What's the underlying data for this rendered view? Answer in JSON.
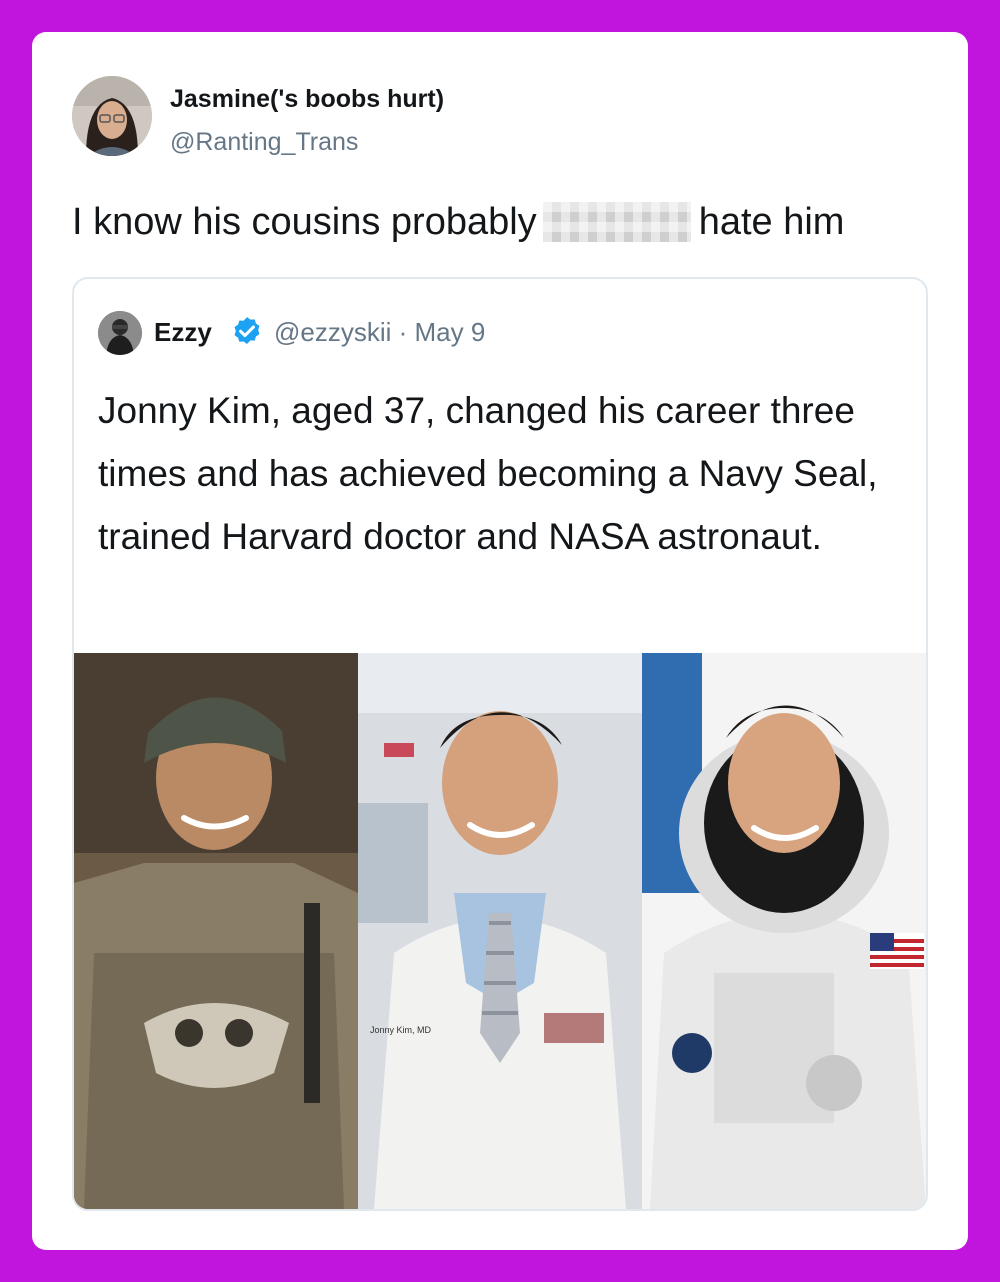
{
  "tweet": {
    "display_name": "Jasmine('s boobs hurt)",
    "handle": "@Ranting_Trans",
    "text_before": "I know his cousins probably",
    "text_after": "hate him"
  },
  "quoted_tweet": {
    "display_name": "Ezzy",
    "verified": true,
    "handle_date": "@ezzyskii · May 9",
    "text": "Jonny Kim, aged 37, changed his career three times and has achieved becoming a Navy Seal, trained Harvard doctor and NASA astronaut.",
    "photo": {
      "panels": [
        "soldier",
        "doctor",
        "astronaut"
      ],
      "coat_name_tag": "Jonny Kim, MD"
    }
  },
  "colors": {
    "background": "#c114dd",
    "card": "#ffffff",
    "text": "#14171a",
    "secondary_text": "#657786",
    "verified_blue": "#1da1f2",
    "border": "#e1e8ed"
  }
}
